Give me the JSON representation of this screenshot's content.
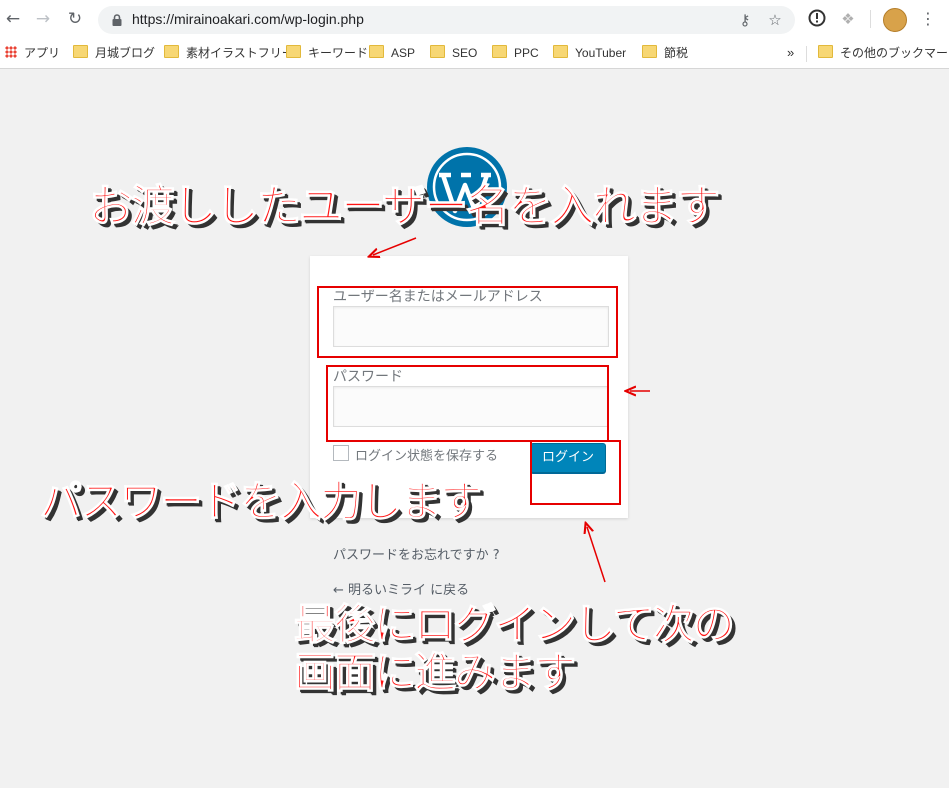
{
  "browser": {
    "url": "https://mirainoakari.com/wp-login.php",
    "bookmarks": [
      {
        "label": "アプリ",
        "icon": "apps-grid-icon"
      },
      {
        "label": "月城ブログ",
        "icon": "folder-icon"
      },
      {
        "label": "素材イラストフリー",
        "icon": "folder-icon"
      },
      {
        "label": "キーワード",
        "icon": "folder-icon"
      },
      {
        "label": "ASP",
        "icon": "folder-icon"
      },
      {
        "label": "SEO",
        "icon": "folder-icon"
      },
      {
        "label": "PPC",
        "icon": "folder-icon"
      },
      {
        "label": "YouTuber",
        "icon": "folder-icon"
      },
      {
        "label": "節税",
        "icon": "folder-icon"
      }
    ],
    "overflow": "»",
    "other_bookmarks": "その他のブックマーク"
  },
  "login": {
    "username_label": "ユーザー名またはメールアドレス",
    "username_value": "",
    "password_label": "パスワード",
    "password_value": "",
    "remember_label": "ログイン状態を保存する",
    "login_button": "ログイン",
    "lost_password": "パスワードをお忘れですか ?",
    "back_link": "← 明るいミライ に戻る"
  },
  "annotations": {
    "username": "お渡ししたユーザー名を入れます",
    "password": "パスワードを入力します",
    "login_line1": "最後にログインして次の",
    "login_line2": "画面に進みます",
    "color": "#ff1414"
  },
  "colors": {
    "accent": "#0085ba",
    "background": "#f1f1f1",
    "wp_logo": "#0073aa"
  }
}
